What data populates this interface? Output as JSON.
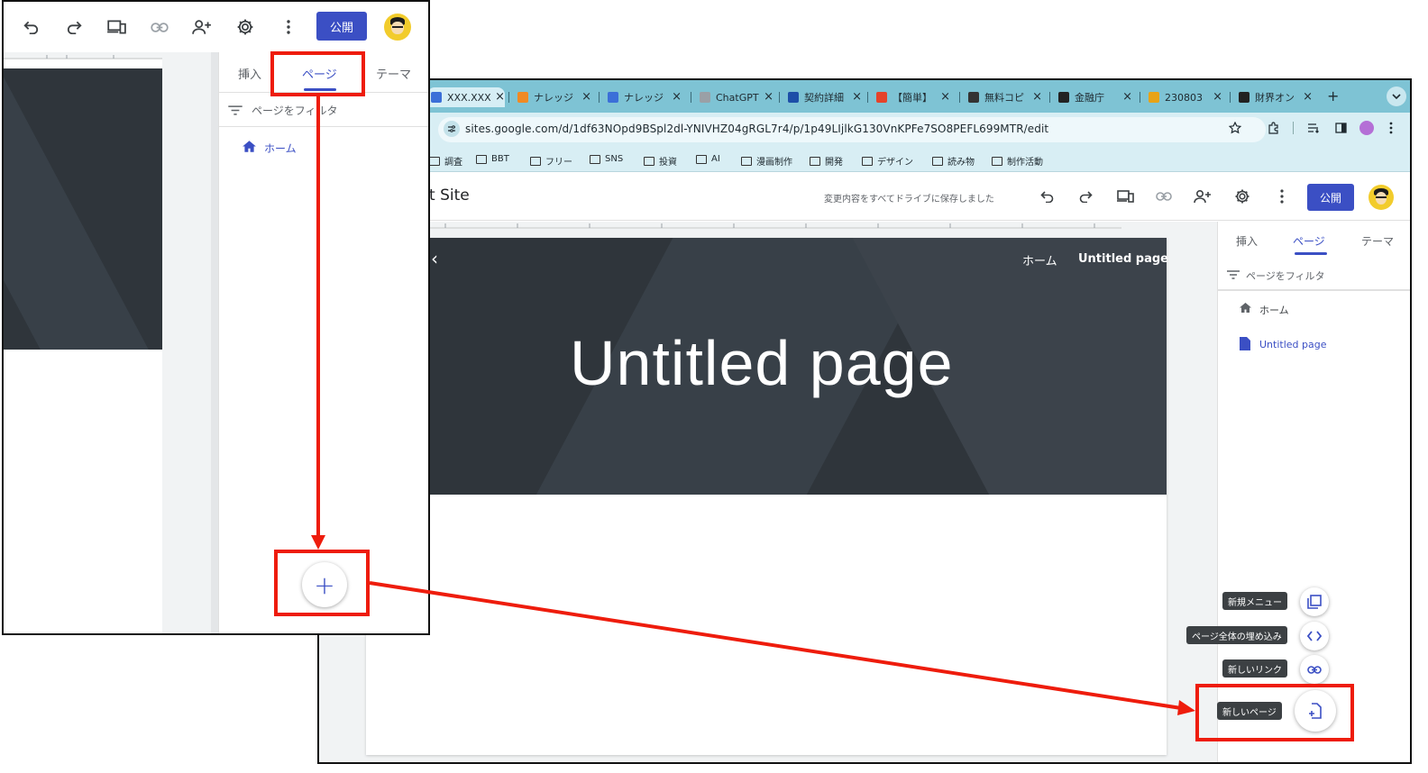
{
  "browser": {
    "tabs": [
      {
        "label": "XXX.XXX",
        "color": "#3b6fd8"
      },
      {
        "label": "ナレッジ",
        "color": "#f08a24"
      },
      {
        "label": "ナレッジ",
        "color": "#3b6fd8"
      },
      {
        "label": "ChatGPT",
        "color": "#9aa0a6"
      },
      {
        "label": "契約詳細",
        "color": "#1d4fa8"
      },
      {
        "label": "【簡単】",
        "color": "#e5432a"
      },
      {
        "label": "無料コピ",
        "color": "#333333"
      },
      {
        "label": "金融庁",
        "color": "#222222"
      },
      {
        "label": "230803",
        "color": "#e8a317"
      },
      {
        "label": "財界オン",
        "color": "#222222"
      }
    ],
    "tab_close": "×",
    "new_tab": "+",
    "url": "sites.google.com/d/1df63NOpd9BSpl2dl-YNIVHZ04gRGL7r4/p/1p49LIjlkG130VnKPFe7SO8PEFL699MTR/edit",
    "bookmarks": [
      "調査",
      "BBT",
      "フリー",
      "SNS",
      "投資",
      "AI",
      "漫画制作",
      "開発",
      "デザイン",
      "読み物",
      "制作活動"
    ]
  },
  "editor": {
    "site_title": "t Site",
    "saved_message": "変更内容をすべてドライブに保存しました",
    "publish_label": "公開",
    "hero_title": "Untitled page",
    "nav_home": "ホーム",
    "nav_page": "Untitled page",
    "back_chevron": "‹",
    "sidebar": {
      "tabs": [
        "挿入",
        "ページ",
        "テーマ"
      ],
      "filter": "ページをフィルタ",
      "pages": [
        "ホーム",
        "Untitled page"
      ]
    },
    "fab_menu": {
      "new_menu": "新規メニュー",
      "embed_page": "ページ全体の埋め込み",
      "new_link": "新しいリンク",
      "new_page": "新しいページ"
    }
  },
  "zoom": {
    "publish_label": "公開",
    "tabs": [
      "挿入",
      "ページ",
      "テーマ"
    ],
    "filter": "ページをフィルタ",
    "home": "ホーム",
    "fab_plus": "+"
  },
  "colors": {
    "accent": "#3b4fc4",
    "annotation": "#ee1c0c",
    "tabbar": "#7ec3d4",
    "hero": "#2f353b"
  }
}
